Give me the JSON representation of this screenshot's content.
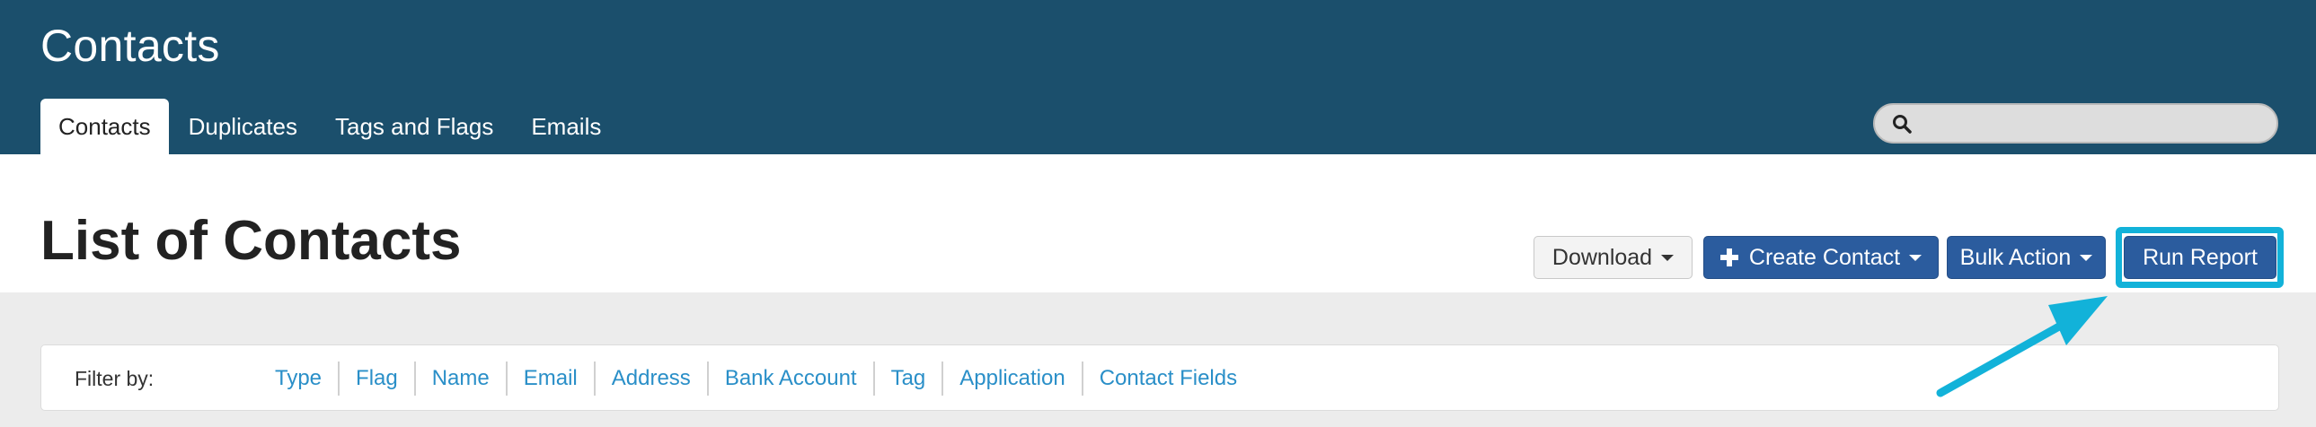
{
  "header": {
    "title": "Contacts",
    "tabs": [
      {
        "label": "Contacts"
      },
      {
        "label": "Duplicates"
      },
      {
        "label": "Tags and Flags"
      },
      {
        "label": "Emails"
      }
    ],
    "search": {
      "placeholder": "",
      "value": ""
    }
  },
  "main": {
    "title": "List of Contacts",
    "buttons": {
      "download": "Download",
      "create_contact": "Create Contact",
      "bulk_action": "Bulk Action",
      "run_report": "Run Report"
    }
  },
  "filter": {
    "label": "Filter by:",
    "items": [
      "Type",
      "Flag",
      "Name",
      "Email",
      "Address",
      "Bank Account",
      "Tag",
      "Application",
      "Contact Fields"
    ]
  },
  "colors": {
    "header_bg": "#1b4f6c",
    "primary_button": "#2b5c9e",
    "highlight": "#12b2d9",
    "link": "#2a8fc8"
  }
}
